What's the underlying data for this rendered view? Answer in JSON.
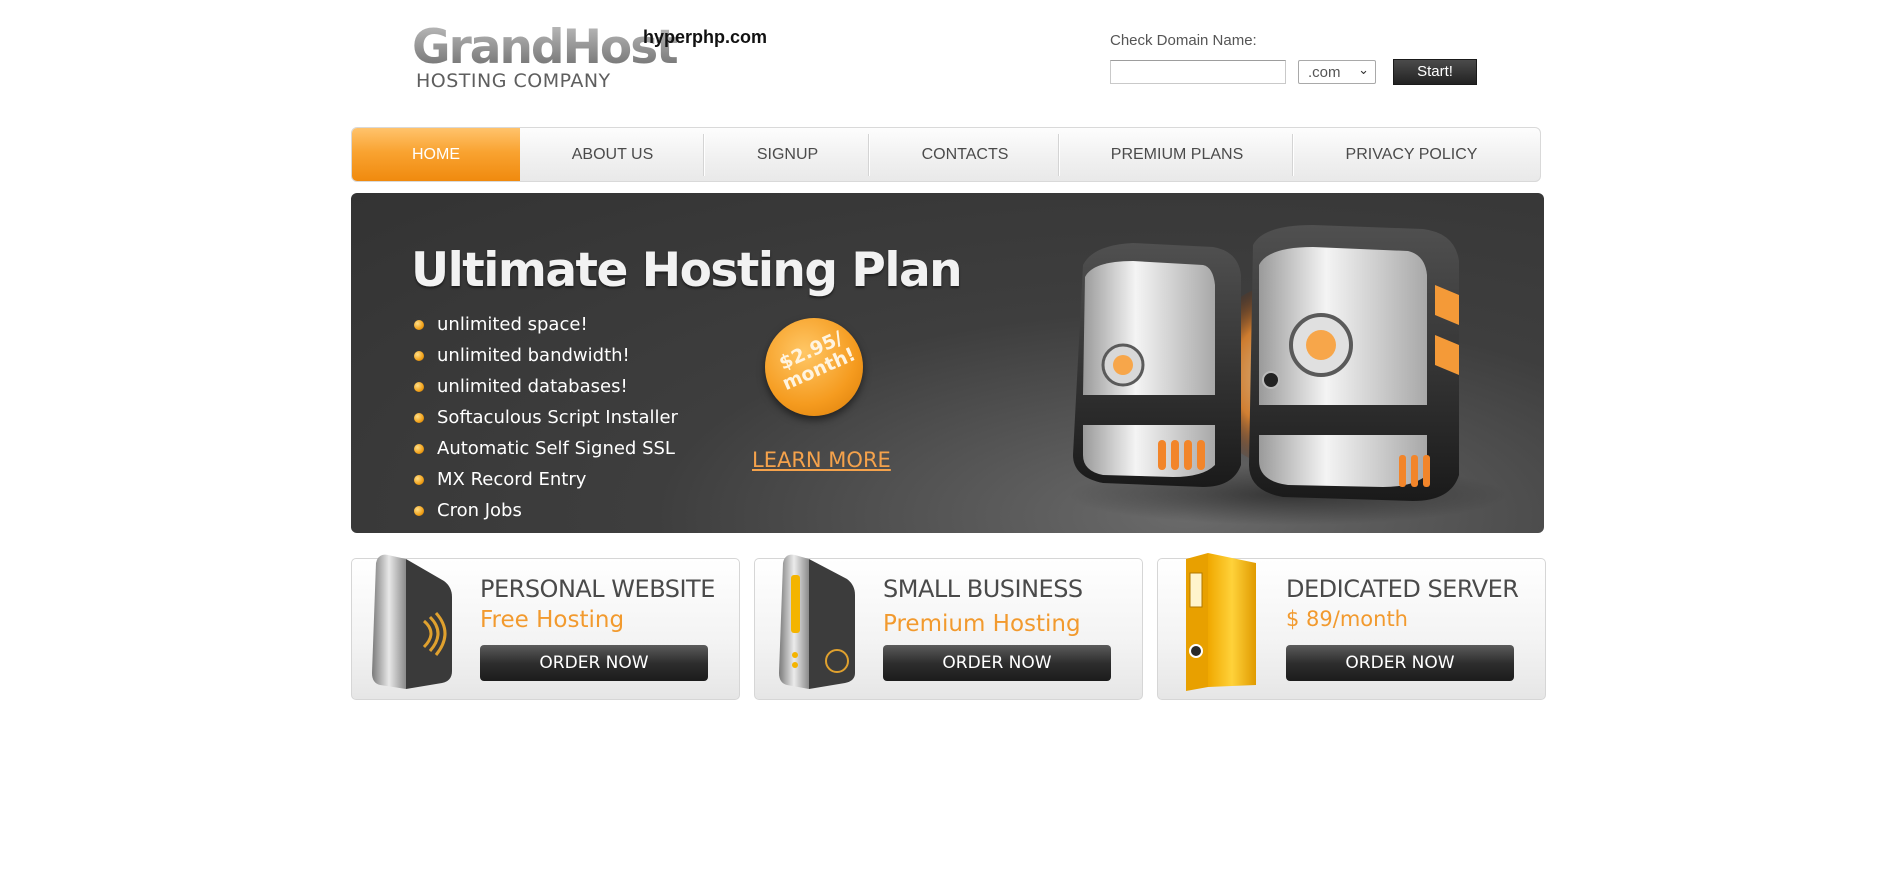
{
  "header": {
    "logo_main": "GrandHost",
    "logo_sub": "HOSTING COMPANY",
    "site_name": "hyperphp.com",
    "domain_check": {
      "label": "Check Domain Name:",
      "input_value": "",
      "tld_selected": ".com",
      "button_label": "Start!"
    }
  },
  "nav": {
    "items": [
      {
        "label": "HOME",
        "active": true
      },
      {
        "label": "ABOUT US"
      },
      {
        "label": "SIGNUP"
      },
      {
        "label": "CONTACTS"
      },
      {
        "label": "PREMIUM PLANS"
      },
      {
        "label": "PRIVACY POLICY"
      }
    ]
  },
  "banner": {
    "title": "Ultimate Hosting Plan",
    "features": [
      "unlimited space!",
      "unlimited bandwidth!",
      "unlimited databases!",
      "Softaculous Script Installer",
      "Automatic Self Signed SSL",
      "MX Record Entry",
      "Cron Jobs"
    ],
    "price_line1": "$2.95/",
    "price_line2": "month!",
    "learn_more": "LEARN MORE"
  },
  "products": [
    {
      "title": "PERSONAL WEBSITE",
      "subtitle": "Free Hosting",
      "button": "ORDER NOW",
      "icon": "personal-server-icon"
    },
    {
      "title": "SMALL BUSINESS",
      "subtitle": "Premium Hosting",
      "button": "ORDER NOW",
      "icon": "business-server-icon"
    },
    {
      "title": "DEDICATED SERVER",
      "subtitle": "$ 89/month",
      "button": "ORDER NOW",
      "icon": "binder-folder-icon"
    }
  ],
  "colors": {
    "accent_orange": "#f59b1f",
    "nav_text": "#4b4b4b",
    "banner_bg": "#3a3a3a"
  }
}
